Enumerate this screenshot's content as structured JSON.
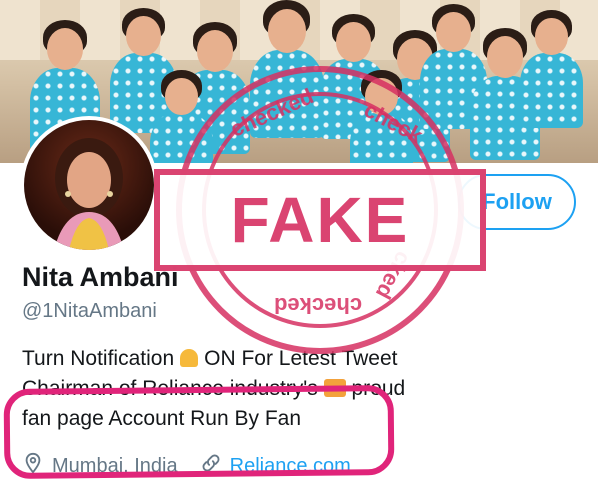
{
  "profile": {
    "name": "Nita Ambani",
    "handle": "@1NitaAmbani",
    "follow_label": "Follow",
    "bio_lines": [
      "Turn Notification",
      "ON For Letest Tweet",
      "Chairman of Reliance industry's",
      "proud",
      "fan page  Account Run By Fan"
    ],
    "location": "Mumbai, India",
    "website": "Reliance.com"
  },
  "stamp": {
    "label": "FAKE",
    "ring_text_top": "checked",
    "ring_text_top_right": "check",
    "ring_text_bottom": "checked",
    "ring_text_bottom_right": "cked"
  },
  "colors": {
    "twitter_blue": "#1da1f2",
    "stamp_pink": "#d63062",
    "highlight_pink": "#e0247a"
  },
  "icons": {
    "bell": "bell-icon",
    "location": "location-pin-icon",
    "link": "link-icon"
  }
}
